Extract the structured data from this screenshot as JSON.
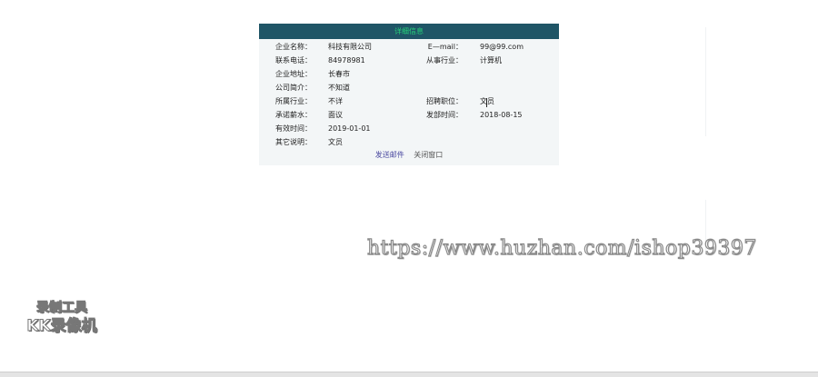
{
  "panel": {
    "title": "详细信息",
    "rows": [
      {
        "label1": "企业名称：",
        "value1": "科技有限公司",
        "label2": "E—mail：",
        "value2": "99@99.com"
      },
      {
        "label1": "联系电话：",
        "value1": "84978981",
        "label2": "从事行业：",
        "value2": "计算机"
      },
      {
        "label1": "企业地址：",
        "value1": "长春市",
        "label2": "",
        "value2": ""
      },
      {
        "label1": "公司简介：",
        "value1": "不知道",
        "label2": "",
        "value2": ""
      },
      {
        "label1": "所属行业：",
        "value1": "不详",
        "label2": "招聘职位：",
        "value2": "文员"
      },
      {
        "label1": "承诺薪水：",
        "value1": "面议",
        "label2": "发部时间：",
        "value2": "2018-08-15"
      },
      {
        "label1": "有效时间：",
        "value1": "2019-01-01",
        "label2": "",
        "value2": ""
      },
      {
        "label1": "其它说明：",
        "value1": "文员",
        "label2": "",
        "value2": ""
      }
    ],
    "send_mail_label": "发送邮件",
    "close_window_label": "关闭窗口"
  },
  "watermark": {
    "url": "https://www.huzhan.com/ishop39397",
    "recorder_line1": "录制工具",
    "recorder_line2": "KK录像机"
  },
  "colors": {
    "header_bg": "#1f5566",
    "header_text": "#27d37a",
    "panel_bg": "#f3f6f7",
    "link": "#4b4aa0"
  }
}
